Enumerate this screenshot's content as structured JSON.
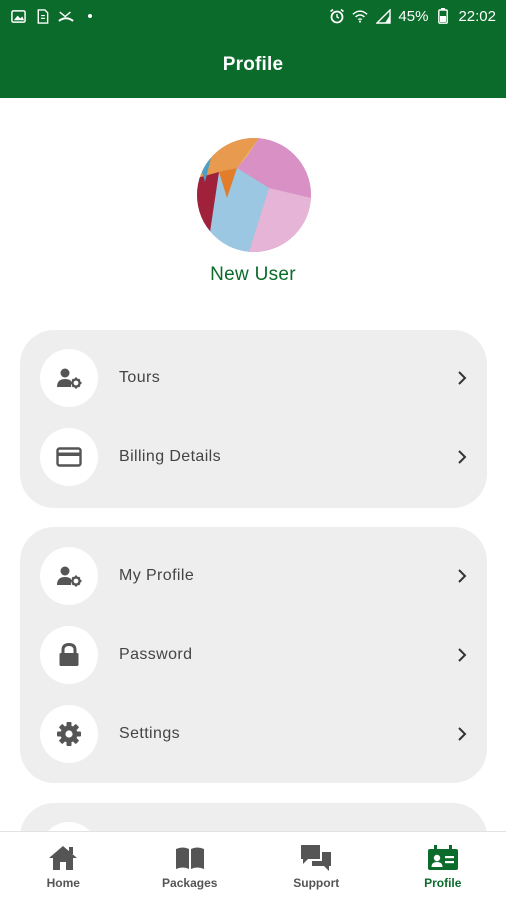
{
  "status_bar": {
    "battery": "45%",
    "time": "22:02"
  },
  "app_bar": {
    "title": "Profile"
  },
  "user": {
    "name": "New User"
  },
  "menu_groups": [
    {
      "items": [
        {
          "label": "Tours",
          "icon": "user-gear-icon"
        },
        {
          "label": "Billing Details",
          "icon": "credit-card-icon"
        }
      ]
    },
    {
      "items": [
        {
          "label": "My Profile",
          "icon": "user-gear-icon"
        },
        {
          "label": "Password",
          "icon": "lock-icon"
        },
        {
          "label": "Settings",
          "icon": "gear-icon"
        }
      ]
    }
  ],
  "bottom_nav": {
    "active": "Profile",
    "items": [
      {
        "label": "Home",
        "icon": "home-icon"
      },
      {
        "label": "Packages",
        "icon": "book-icon"
      },
      {
        "label": "Support",
        "icon": "chat-icon"
      },
      {
        "label": "Profile",
        "icon": "id-card-icon"
      }
    ]
  },
  "colors": {
    "brand_green": "#0a6b2a",
    "card_bg": "#eeeeee",
    "nav_inactive": "#555555"
  }
}
